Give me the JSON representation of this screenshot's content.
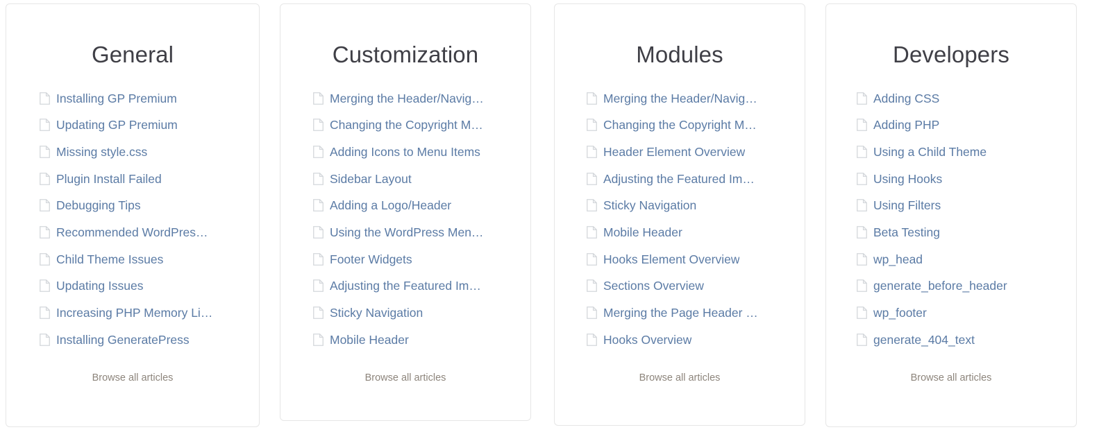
{
  "theme": {
    "page_background": "#ffffff",
    "card_background": "#ffffff",
    "card_border": "#e6e6e6",
    "heading_color": "#3f3f46",
    "link_color": "#5b7ba5",
    "browse_link_color": "#8d857c",
    "icon_color": "#d4d7db"
  },
  "icons": {
    "document": "document-icon"
  },
  "browse_label": "Browse all articles",
  "columns": [
    {
      "title": "General",
      "browse_label": "Browse all articles",
      "articles": [
        "Installing GP Premium",
        "Updating GP Premium",
        "Missing style.css",
        "Plugin Install Failed",
        "Debugging Tips",
        "Recommended WordPres…",
        "Child Theme Issues",
        "Updating Issues",
        "Increasing PHP Memory Li…",
        "Installing GeneratePress"
      ]
    },
    {
      "title": "Customization",
      "browse_label": "Browse all articles",
      "articles": [
        "Merging the Header/Navig…",
        "Changing the Copyright M…",
        "Adding Icons to Menu Items",
        "Sidebar Layout",
        "Adding a Logo/Header",
        "Using the WordPress Men…",
        "Footer Widgets",
        "Adjusting the Featured Im…",
        "Sticky Navigation",
        "Mobile Header"
      ]
    },
    {
      "title": "Modules",
      "browse_label": "Browse all articles",
      "articles": [
        "Merging the Header/Navig…",
        "Changing the Copyright M…",
        "Header Element Overview",
        "Adjusting the Featured Im…",
        "Sticky Navigation",
        "Mobile Header",
        "Hooks Element Overview",
        "Sections Overview",
        "Merging the Page Header …",
        "Hooks Overview"
      ]
    },
    {
      "title": "Developers",
      "browse_label": "Browse all articles",
      "articles": [
        "Adding CSS",
        "Adding PHP",
        "Using a Child Theme",
        "Using Hooks",
        "Using Filters",
        "Beta Testing",
        "wp_head",
        "generate_before_header",
        "wp_footer",
        "generate_404_text"
      ]
    }
  ]
}
